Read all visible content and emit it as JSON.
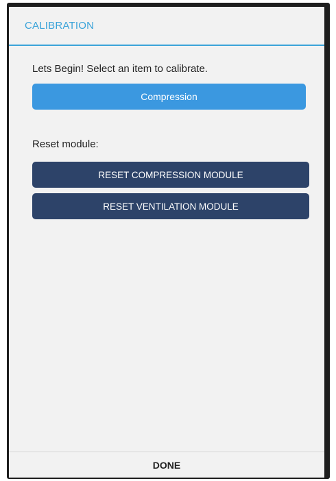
{
  "dialog": {
    "title": "CALIBRATION"
  },
  "body": {
    "prompt": "Lets Begin! Select an item to calibrate.",
    "calibrate_button": "Compression",
    "reset_label": "Reset module:",
    "reset_compression_button": "RESET COMPRESSION MODULE",
    "reset_ventilation_button": "RESET VENTILATION MODULE"
  },
  "footer": {
    "done_button": "DONE"
  },
  "colors": {
    "accent": "#3aa3d9",
    "primary_button": "#3b98e0",
    "reset_button": "#2d4369"
  }
}
